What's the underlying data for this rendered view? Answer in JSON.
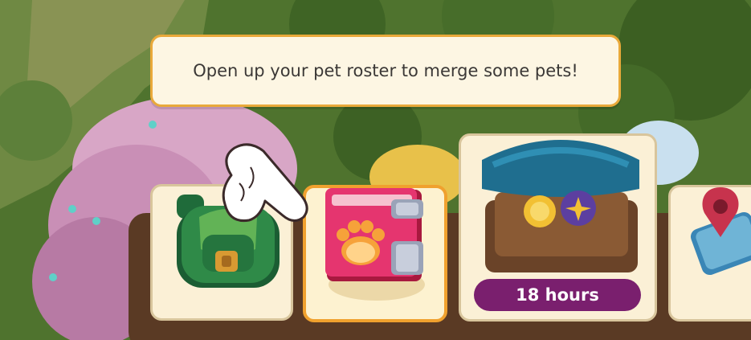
{
  "tutorial": {
    "message": "Open up your pet roster to merge some pets!"
  },
  "slots": [
    {
      "id": "backpack",
      "icon": "backpack-icon"
    },
    {
      "id": "pet-roster",
      "icon": "paw-book-icon",
      "highlighted": true
    },
    {
      "id": "shop",
      "icon": "shop-stall-icon",
      "timer": "18 hours"
    },
    {
      "id": "map",
      "icon": "map-pin-icon"
    }
  ],
  "colors": {
    "highlight_border": "#f0a12e",
    "timer_bg": "#7a1f6e",
    "book_cover": "#e5356f"
  }
}
